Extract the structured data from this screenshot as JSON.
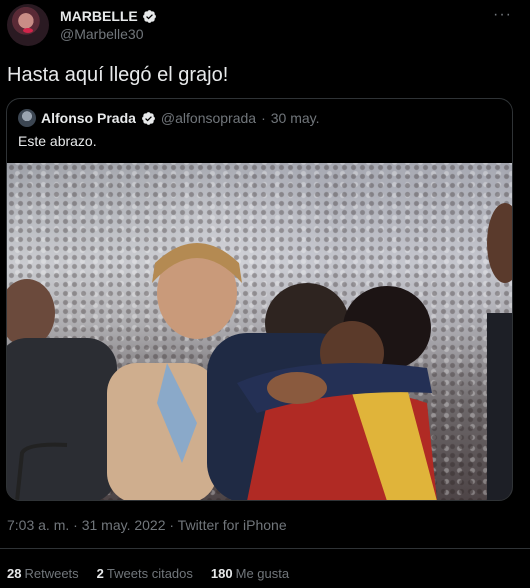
{
  "author": {
    "display_name": "MARBELLE",
    "handle": "@Marbelle30"
  },
  "tweet": {
    "text": "Hasta aquí llegó el grajo!"
  },
  "more_label": "···",
  "quoted_tweet": {
    "display_name": "Alfonso Prada",
    "handle": "@alfonsoprada",
    "separator": "·",
    "date": "30 may.",
    "text": "Este abrazo."
  },
  "meta": {
    "timestamp": "7:03 a. m. · 31 may. 2022 · Twitter for iPhone"
  },
  "stats": [
    {
      "count": "28",
      "label": "Retweets"
    },
    {
      "count": "2",
      "label": "Tweets citados"
    },
    {
      "count": "180",
      "label": "Me gusta"
    }
  ],
  "colors": {
    "background": "#000000",
    "text": "#e7e9ea",
    "secondary": "#71767b",
    "border": "#2f3336",
    "verified": "#1d9bf0"
  }
}
